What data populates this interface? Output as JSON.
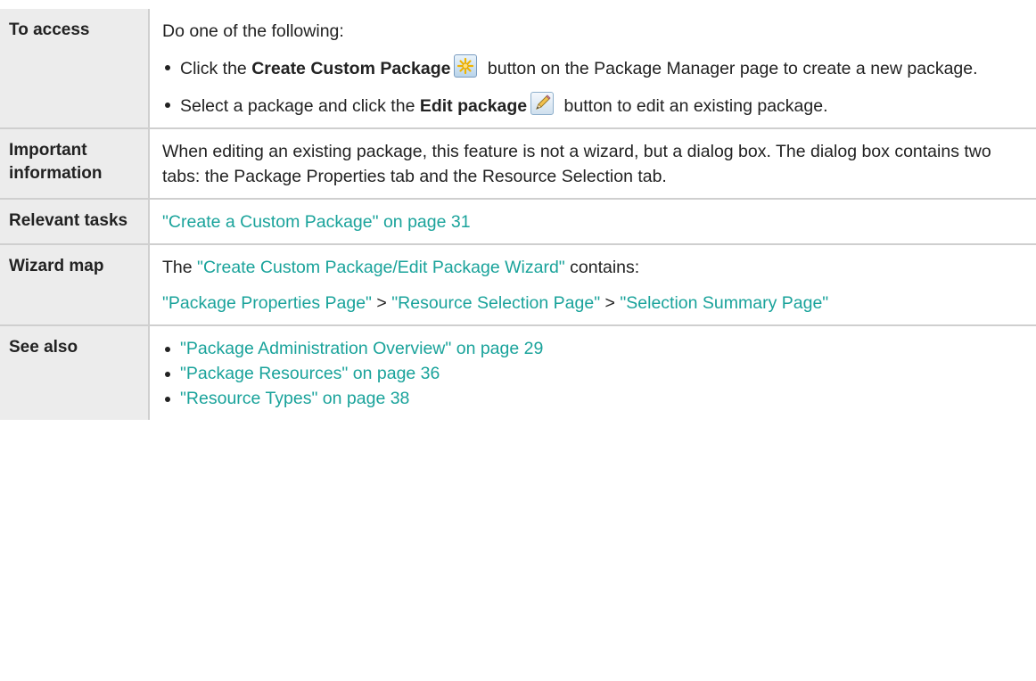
{
  "rows": [
    {
      "label": "To access",
      "intro": "Do one of the following:",
      "items": [
        {
          "pre": "Click the ",
          "bold": "Create Custom Package",
          "post": " button on the Package Manager page to create a new package.",
          "icon": "create-package-icon"
        },
        {
          "pre": "Select a package and click the ",
          "bold": "Edit package",
          "post": " button to edit an existing package.",
          "icon": "edit-pencil-icon"
        }
      ]
    },
    {
      "label": "Important information",
      "text": "When editing an existing package, this feature is not a wizard, but a dialog box. The dialog box contains two tabs: the Package Properties tab and the Resource Selection tab."
    },
    {
      "label": "Relevant tasks",
      "link": "\"Create a Custom Package\" on page 31"
    },
    {
      "label": "Wizard map",
      "line1_pre": "The ",
      "line1_link": "\"Create Custom Package/Edit Package Wizard\"",
      "line1_post": " contains:",
      "map": [
        "\"Package Properties Page\"",
        "\"Resource Selection Page\"",
        "\"Selection Summary Page\""
      ],
      "separator": " > "
    },
    {
      "label": "See also",
      "links": [
        "\"Package Administration Overview\" on page 29",
        "\"Package Resources\" on page 36",
        "\"Resource Types\" on page 38"
      ]
    }
  ],
  "colors": {
    "link": "#1aa39b",
    "label_bg": "#ececec",
    "border": "#cfcfcf",
    "text": "#222222"
  }
}
